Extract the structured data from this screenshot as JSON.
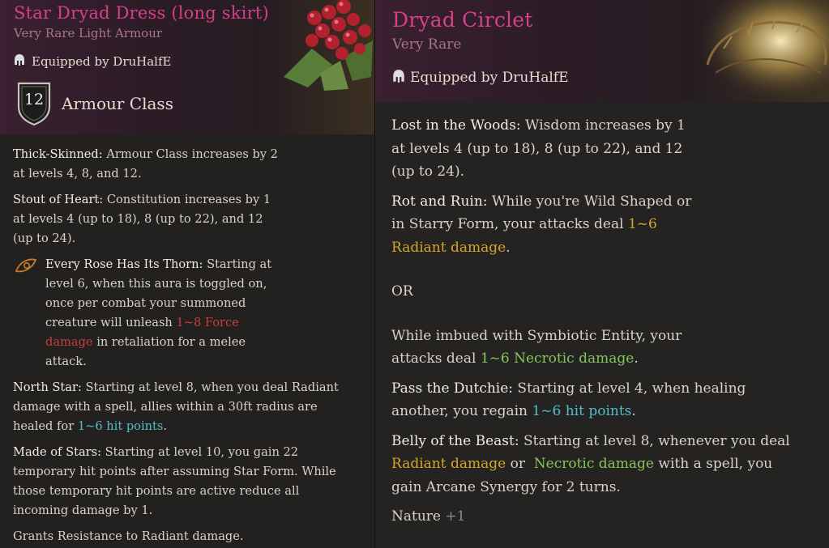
{
  "left": {
    "title": "Star Dryad Dress (long skirt)",
    "rarity": "Very Rare Light Armour",
    "equipped": "Equipped by DruHalfE",
    "ac_value": "12",
    "ac_label": "Armour Class",
    "props": [
      {
        "name": "Thick-Skinned:",
        "line1": " Armour Class increases by 2",
        "line2": "at levels 4, 8, and 12."
      },
      {
        "name": "Stout of Heart:",
        "line1": " Constitution increases by 1",
        "line2": "at levels 4 (up to 18), 8 (up to 22), and 12",
        "line3": "(up to 24)."
      },
      {
        "name": "Every Rose Has Its Thorn:",
        "t1": " Starting at",
        "t2": "level 6, when this aura is toggled on,",
        "t3": "once per combat your summoned",
        "t4": "creature will unleash ",
        "dmg1": "1~8 Force",
        "dmg2": "damage",
        "t5": " in retaliation for a melee",
        "t6": "attack."
      },
      {
        "name": "North Star:",
        "t1": " Starting at level 8, when you deal Radiant",
        "t2": "damage with a spell, allies within a 30ft radius are",
        "t3": "healed for ",
        "hp": "1~6 hit points",
        "t4": "."
      },
      {
        "name": "Made of Stars:",
        "t1": " Starting at level 10, you gain 22",
        "t2": "temporary hit points after assuming Star Form. While",
        "t3": "those temporary hit points are active reduce all",
        "t4": "incoming damage by 1."
      },
      {
        "text": "Grants Resistance to Radiant damage."
      }
    ]
  },
  "right": {
    "title": "Dryad Circlet",
    "rarity": "Very Rare",
    "equipped": "Equipped by DruHalfE",
    "p1": {
      "name": "Lost in the Woods:",
      "t1": " Wisdom increases by 1",
      "t2": "at levels 4 (up to 18), 8 (up to 22), and 12",
      "t3": "(up to 24)."
    },
    "p2": {
      "name": "Rot and Ruin:",
      "t1": " While you're Wild Shaped or",
      "t2": "in Starry Form, your attacks deal ",
      "d1": "1~6",
      "d2": "Radiant damage",
      "t3": "."
    },
    "or": "OR",
    "p3": {
      "t1": "While imbued with Symbiotic Entity, your",
      "t2": "attacks deal ",
      "d": "1~6 Necrotic damage",
      "t3": "."
    },
    "p4": {
      "name": "Pass the Dutchie:",
      "t1": " Starting at level 4, when healing",
      "t2": "another, you regain ",
      "hp": "1~6 hit points",
      "t3": "."
    },
    "p5": {
      "name": "Belly of the Beast:",
      "t1": " Starting at level 8, whenever you deal",
      "rad": "Radiant damage",
      "t2": " or  ",
      "nec": "Necrotic damage",
      "t3": " with a spell, you",
      "t4": "gain Arcane Synergy for 2 turns."
    },
    "skill": "Nature",
    "skill_bonus": "+1"
  },
  "icons": {
    "equipped": "helmet-icon",
    "ac": "shield-icon",
    "aura": "aura-eye-icon"
  },
  "colors": {
    "title": "#d63f8a",
    "force": "#c73c3c",
    "heal": "#53bccc",
    "radiant": "#d4a62a",
    "necrotic": "#84c65a"
  }
}
